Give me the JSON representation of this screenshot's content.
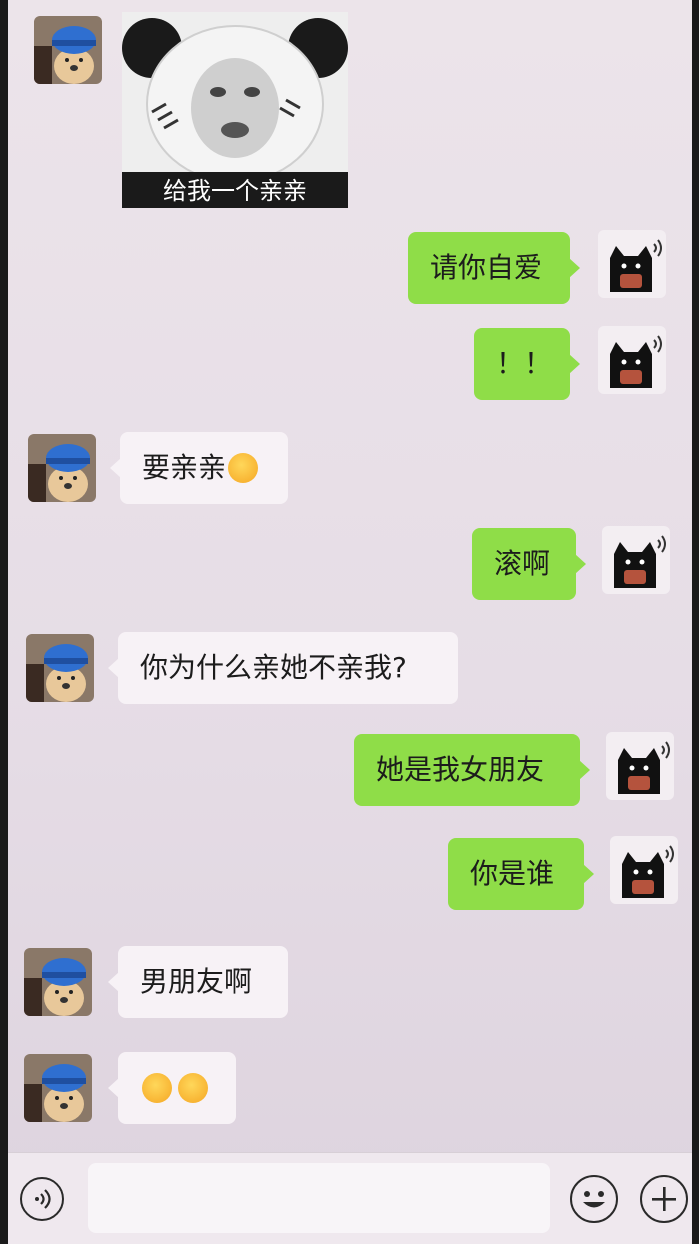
{
  "chat": {
    "meme_caption": "给我一个亲亲",
    "messages": [
      {
        "side": "out",
        "text": "请你自爱"
      },
      {
        "side": "out",
        "text": "！！"
      },
      {
        "side": "in",
        "text": "要亲亲"
      },
      {
        "side": "out",
        "text": "滚啊"
      },
      {
        "side": "in",
        "text": "你为什么亲她不亲我?"
      },
      {
        "side": "out",
        "text": "她是我女朋友"
      },
      {
        "side": "out",
        "text": "你是谁"
      },
      {
        "side": "in",
        "text": "男朋友啊"
      },
      {
        "side": "in",
        "text": ""
      }
    ]
  },
  "input_bar": {
    "voice_icon": "voice-icon",
    "emoji_icon": "emoji-icon",
    "plus_icon": "plus-icon"
  },
  "colors": {
    "outgoing_bubble": "#8fdd48",
    "incoming_bubble": "#f7f2f6",
    "background": "#e9e1e8"
  }
}
